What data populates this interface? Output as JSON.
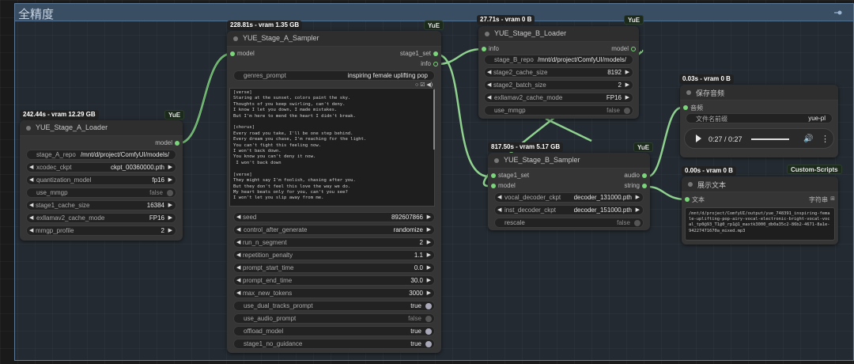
{
  "group": {
    "title": "全精度"
  },
  "nodes": {
    "loaderA": {
      "badge": "242.44s - vram 12.29 GB",
      "tag": "YuE",
      "title": "YUE_Stage_A_Loader",
      "output": "model",
      "widgets": [
        {
          "name": "stage_A_repo",
          "value": "/mnt/d/project/ComfyUI/models/"
        },
        {
          "name": "xcodec_ckpt",
          "value": "ckpt_00360000.pth"
        },
        {
          "name": "quantization_model",
          "value": "fp16"
        },
        {
          "name": "use_mmgp",
          "value": "false"
        },
        {
          "name": "stage1_cache_size",
          "value": "16384"
        },
        {
          "name": "exllamav2_cache_mode",
          "value": "FP16"
        },
        {
          "name": "mmgp_profile",
          "value": "2"
        }
      ]
    },
    "samplerA": {
      "badge": "228.81s - vram 1.35 GB",
      "tag": "YuE",
      "title": "YUE_Stage_A_Sampler",
      "input": "model",
      "outputs": [
        "stage1_set",
        "info"
      ],
      "genres_name": "genres_prompt",
      "genres_value": "inspiring female uplifting pop",
      "lyrics": "[verse]\nStaring at the sunset, colors paint the sky.\nThoughts of you keep swirling, can't deny.\nI know I let you down, I made mistakes.\nBut I'm here to mend the heart I didn't break.\n\n[chorus]\nEvery road you take, I'll be one step behind.\nEvery dream you chase, I'm reaching for the light.\nYou can't fight this feeling now.\nI won't back down.\nYou know you can't deny it now.\n I won't back down\n\n[verse]\nThey might say I'm foolish, chasing after you.\nBut they don't feel this love the way we do.\nMy heart beats only for you, can't you see?\nI won't let you slip away from me.",
      "widgets": [
        {
          "name": "seed",
          "value": "892607866"
        },
        {
          "name": "control_after_generate",
          "value": "randomize"
        },
        {
          "name": "run_n_segment",
          "value": "2"
        },
        {
          "name": "repetition_penalty",
          "value": "1.1"
        },
        {
          "name": "prompt_start_time",
          "value": "0.0"
        },
        {
          "name": "prompt_end_time",
          "value": "30.0"
        },
        {
          "name": "max_new_tokens",
          "value": "3000"
        },
        {
          "name": "use_dual_tracks_prompt",
          "value": "true"
        },
        {
          "name": "use_audio_prompt",
          "value": "false"
        },
        {
          "name": "offload_model",
          "value": "true"
        },
        {
          "name": "stage1_no_guidance",
          "value": "true"
        }
      ]
    },
    "loaderB": {
      "badge": "27.71s - vram 0 B",
      "tag": "YuE",
      "title": "YUE_Stage_B_Loader",
      "input": "info",
      "output": "model",
      "widgets": [
        {
          "name": "stage_B_repo",
          "value": "/mnt/d/project/ComfyUI/models/"
        },
        {
          "name": "stage2_cache_size",
          "value": "8192"
        },
        {
          "name": "stage2_batch_size",
          "value": "2"
        },
        {
          "name": "exllamav2_cache_mode",
          "value": "FP16"
        },
        {
          "name": "use_mmgp",
          "value": "false"
        }
      ]
    },
    "samplerB": {
      "badge": "817.50s - vram 5.17 GB",
      "tag": "YuE",
      "title": "YUE_Stage_B_Sampler",
      "inputs": [
        "stage1_set",
        "model"
      ],
      "outputs": [
        "audio",
        "string"
      ],
      "widgets": [
        {
          "name": "vocal_decoder_ckpt",
          "value": "decoder_131000.pth"
        },
        {
          "name": "inst_decoder_ckpt",
          "value": "decoder_151000.pth"
        },
        {
          "name": "rescale",
          "value": "false"
        }
      ]
    },
    "saveAudio": {
      "badge": "0.03s - vram 0 B",
      "title": "保存音频",
      "input": "音频",
      "prefix_name": "文件名前缀",
      "prefix_value": "yue-pl",
      "time": "0:27 / 0:27"
    },
    "showText": {
      "badge": "0.00s - vram 0 B",
      "tag": "Custom-Scripts",
      "title": "展示文本",
      "input": "文本",
      "output": "字符串",
      "text": "/mnt/d/project/ComfyUI/output/yue_748391_inspiring-female-uplifting-pop-airy-vocal-electronic-bright-vocal-vocal_tp0@93_T1@0_rp1@1_maxtk3000_db0a35c2-86b2-4671-8a1e-94227471670a_mixed.mp3"
    }
  },
  "icons": {
    "pin": "pin-icon",
    "play": "play-icon",
    "volume": "volume-icon",
    "more": "more-vertical-icon"
  }
}
